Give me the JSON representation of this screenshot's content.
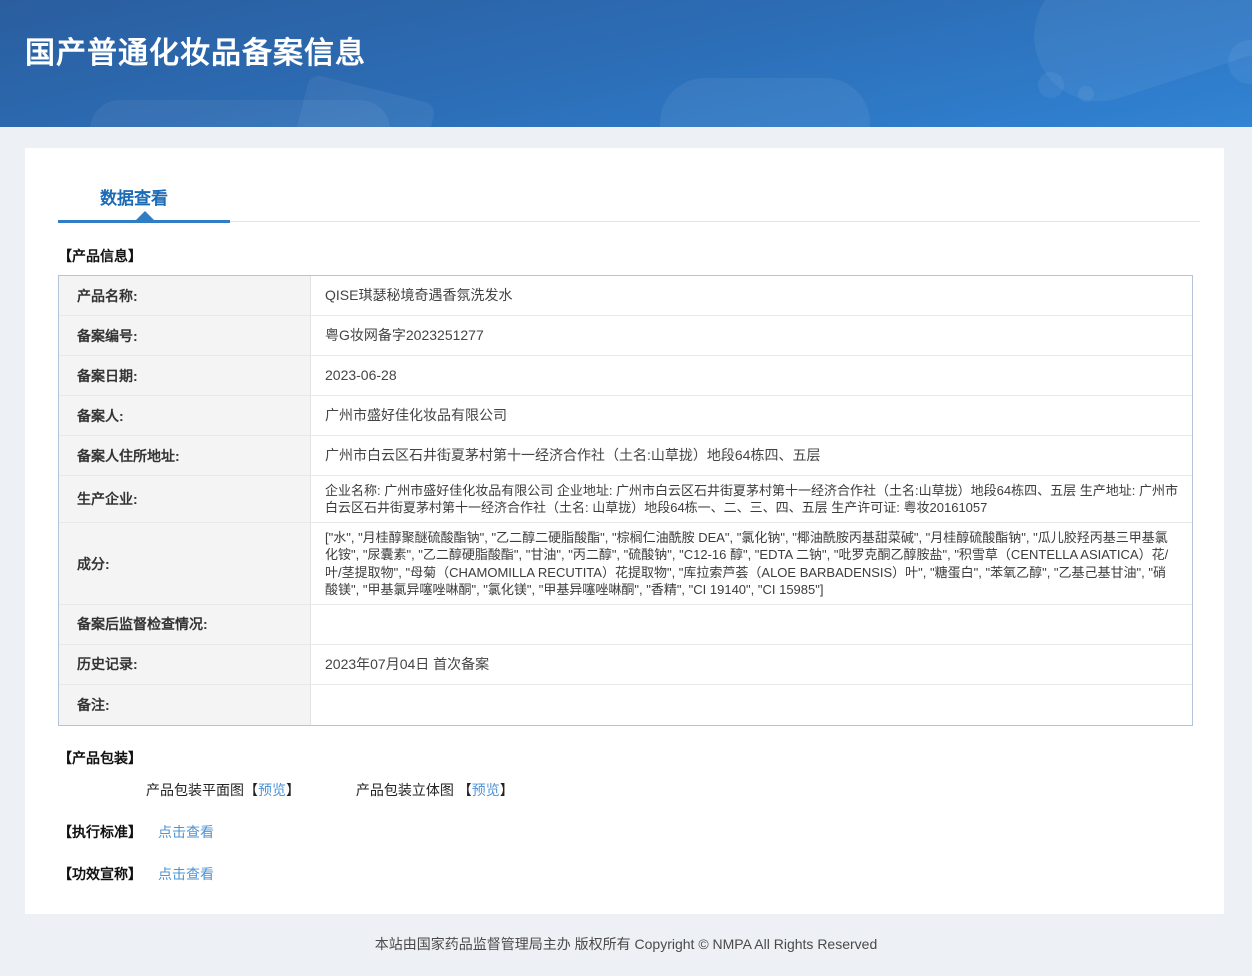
{
  "header": {
    "title": "国产普通化妆品备案信息"
  },
  "tabbar": {
    "active_tab": "数据查看"
  },
  "product_info": {
    "section_title": "【产品信息】",
    "rows": [
      {
        "label": "产品名称:",
        "value": "QISE琪瑟秘境奇遇香氛洗发水"
      },
      {
        "label": "备案编号:",
        "value": "粤G妆网备字2023251277"
      },
      {
        "label": "备案日期:",
        "value": "2023-06-28"
      },
      {
        "label": "备案人:",
        "value": "广州市盛好佳化妆品有限公司"
      },
      {
        "label": "备案人住所地址:",
        "value": "广州市白云区石井街夏茅村第十一经济合作社（土名:山草拢）地段64栋四、五层"
      },
      {
        "label": "生产企业:",
        "value": "企业名称: 广州市盛好佳化妆品有限公司 企业地址: 广州市白云区石井街夏茅村第十一经济合作社（土名:山草拢）地段64栋四、五层 生产地址: 广州市白云区石井街夏茅村第十一经济合作社（土名: 山草拢）地段64栋一、二、三、四、五层 生产许可证: 粤妆20161057"
      },
      {
        "label": "成分:",
        "value": "[\"水\", \"月桂醇聚醚硫酸酯钠\", \"乙二醇二硬脂酸酯\", \"棕榈仁油酰胺 DEA\", \"氯化钠\", \"椰油酰胺丙基甜菜碱\", \"月桂醇硫酸酯钠\", \"瓜儿胶羟丙基三甲基氯化铵\", \"尿囊素\", \"乙二醇硬脂酸酯\", \"甘油\", \"丙二醇\", \"硫酸钠\", \"C12-16 醇\", \"EDTA 二钠\", \"吡罗克酮乙醇胺盐\", \"积雪草（CENTELLA ASIATICA）花/叶/茎提取物\", \"母菊（CHAMOMILLA RECUTITA）花提取物\", \"库拉索芦荟（ALOE BARBADENSIS）叶\", \"糖蛋白\", \"苯氧乙醇\", \"乙基己基甘油\", \"硝酸镁\", \"甲基氯异噻唑啉酮\", \"氯化镁\", \"甲基异噻唑啉酮\", \"香精\", \"CI 19140\", \"CI 15985\"]"
      },
      {
        "label": "备案后监督检查情况:",
        "value": ""
      },
      {
        "label": "历史记录:",
        "value": "2023年07月04日 首次备案"
      },
      {
        "label": "备注:",
        "value": ""
      }
    ]
  },
  "packaging": {
    "section_title": "【产品包装】",
    "items": [
      {
        "prefix": "产品包装平面图【",
        "link": "预览",
        "suffix": "】"
      },
      {
        "prefix": "产品包装立体图 【",
        "link": "预览",
        "suffix": "】"
      }
    ]
  },
  "standards": {
    "title": "【执行标准】",
    "link": "点击查看"
  },
  "efficacy": {
    "title": "【功效宣称】",
    "link": "点击查看"
  },
  "footer": {
    "text": "本站由国家药品监督管理局主办 版权所有 Copyright © NMPA All Rights Reserved"
  },
  "colors": {
    "banner_blue_top": "#2a5e9f",
    "banner_blue_bottom": "#3384d4",
    "tab_blue": "#1b6bb5",
    "underline_blue": "#2f7dc4",
    "link_blue": "#4d94d6",
    "label_bg": "#f4f4f4",
    "table_border": "#b3c4da",
    "page_bg": "#edf0f4"
  }
}
